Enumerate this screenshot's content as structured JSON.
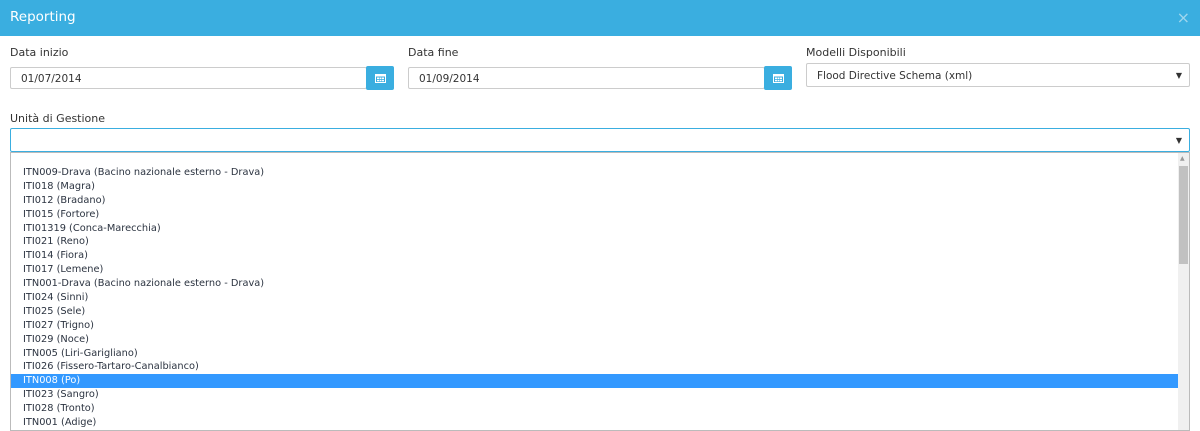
{
  "modal": {
    "title": "Reporting",
    "close_symbol": "×"
  },
  "form": {
    "data_inizio": {
      "label": "Data inizio",
      "value": "01/07/2014"
    },
    "data_fine": {
      "label": "Data fine",
      "value": "01/09/2014"
    },
    "modelli": {
      "label": "Modelli Disponibili",
      "selected": "Flood Directive Schema (xml)"
    },
    "unita": {
      "label": "Unità di Gestione",
      "selected": ""
    }
  },
  "icons": {
    "calendar": "calendar-icon",
    "caret": "▼",
    "scroll_up": "▲"
  },
  "colors": {
    "header": "#3aaee0",
    "button": "#3aaee0",
    "selected_row": "#3399ff"
  },
  "unita_options": [
    "ITN009-Drava (Bacino nazionale esterno - Drava)",
    "ITI018 (Magra)",
    "ITI012 (Bradano)",
    "ITI015 (Fortore)",
    "ITI01319 (Conca-Marecchia)",
    "ITI021 (Reno)",
    "ITI014 (Fiora)",
    "ITI017 (Lemene)",
    "ITN001-Drava (Bacino nazionale esterno - Drava)",
    "ITI024 (Sinni)",
    "ITI025 (Sele)",
    "ITI027 (Trigno)",
    "ITI029 (Noce)",
    "ITN005 (Liri-Garigliano)",
    "ITI026 (Fissero-Tartaro-Canalbianco)",
    "ITN008 (Po)",
    "ITI023 (Sangro)",
    "ITI028 (Tronto)",
    "ITN001 (Adige)"
  ],
  "selected_index": 15
}
